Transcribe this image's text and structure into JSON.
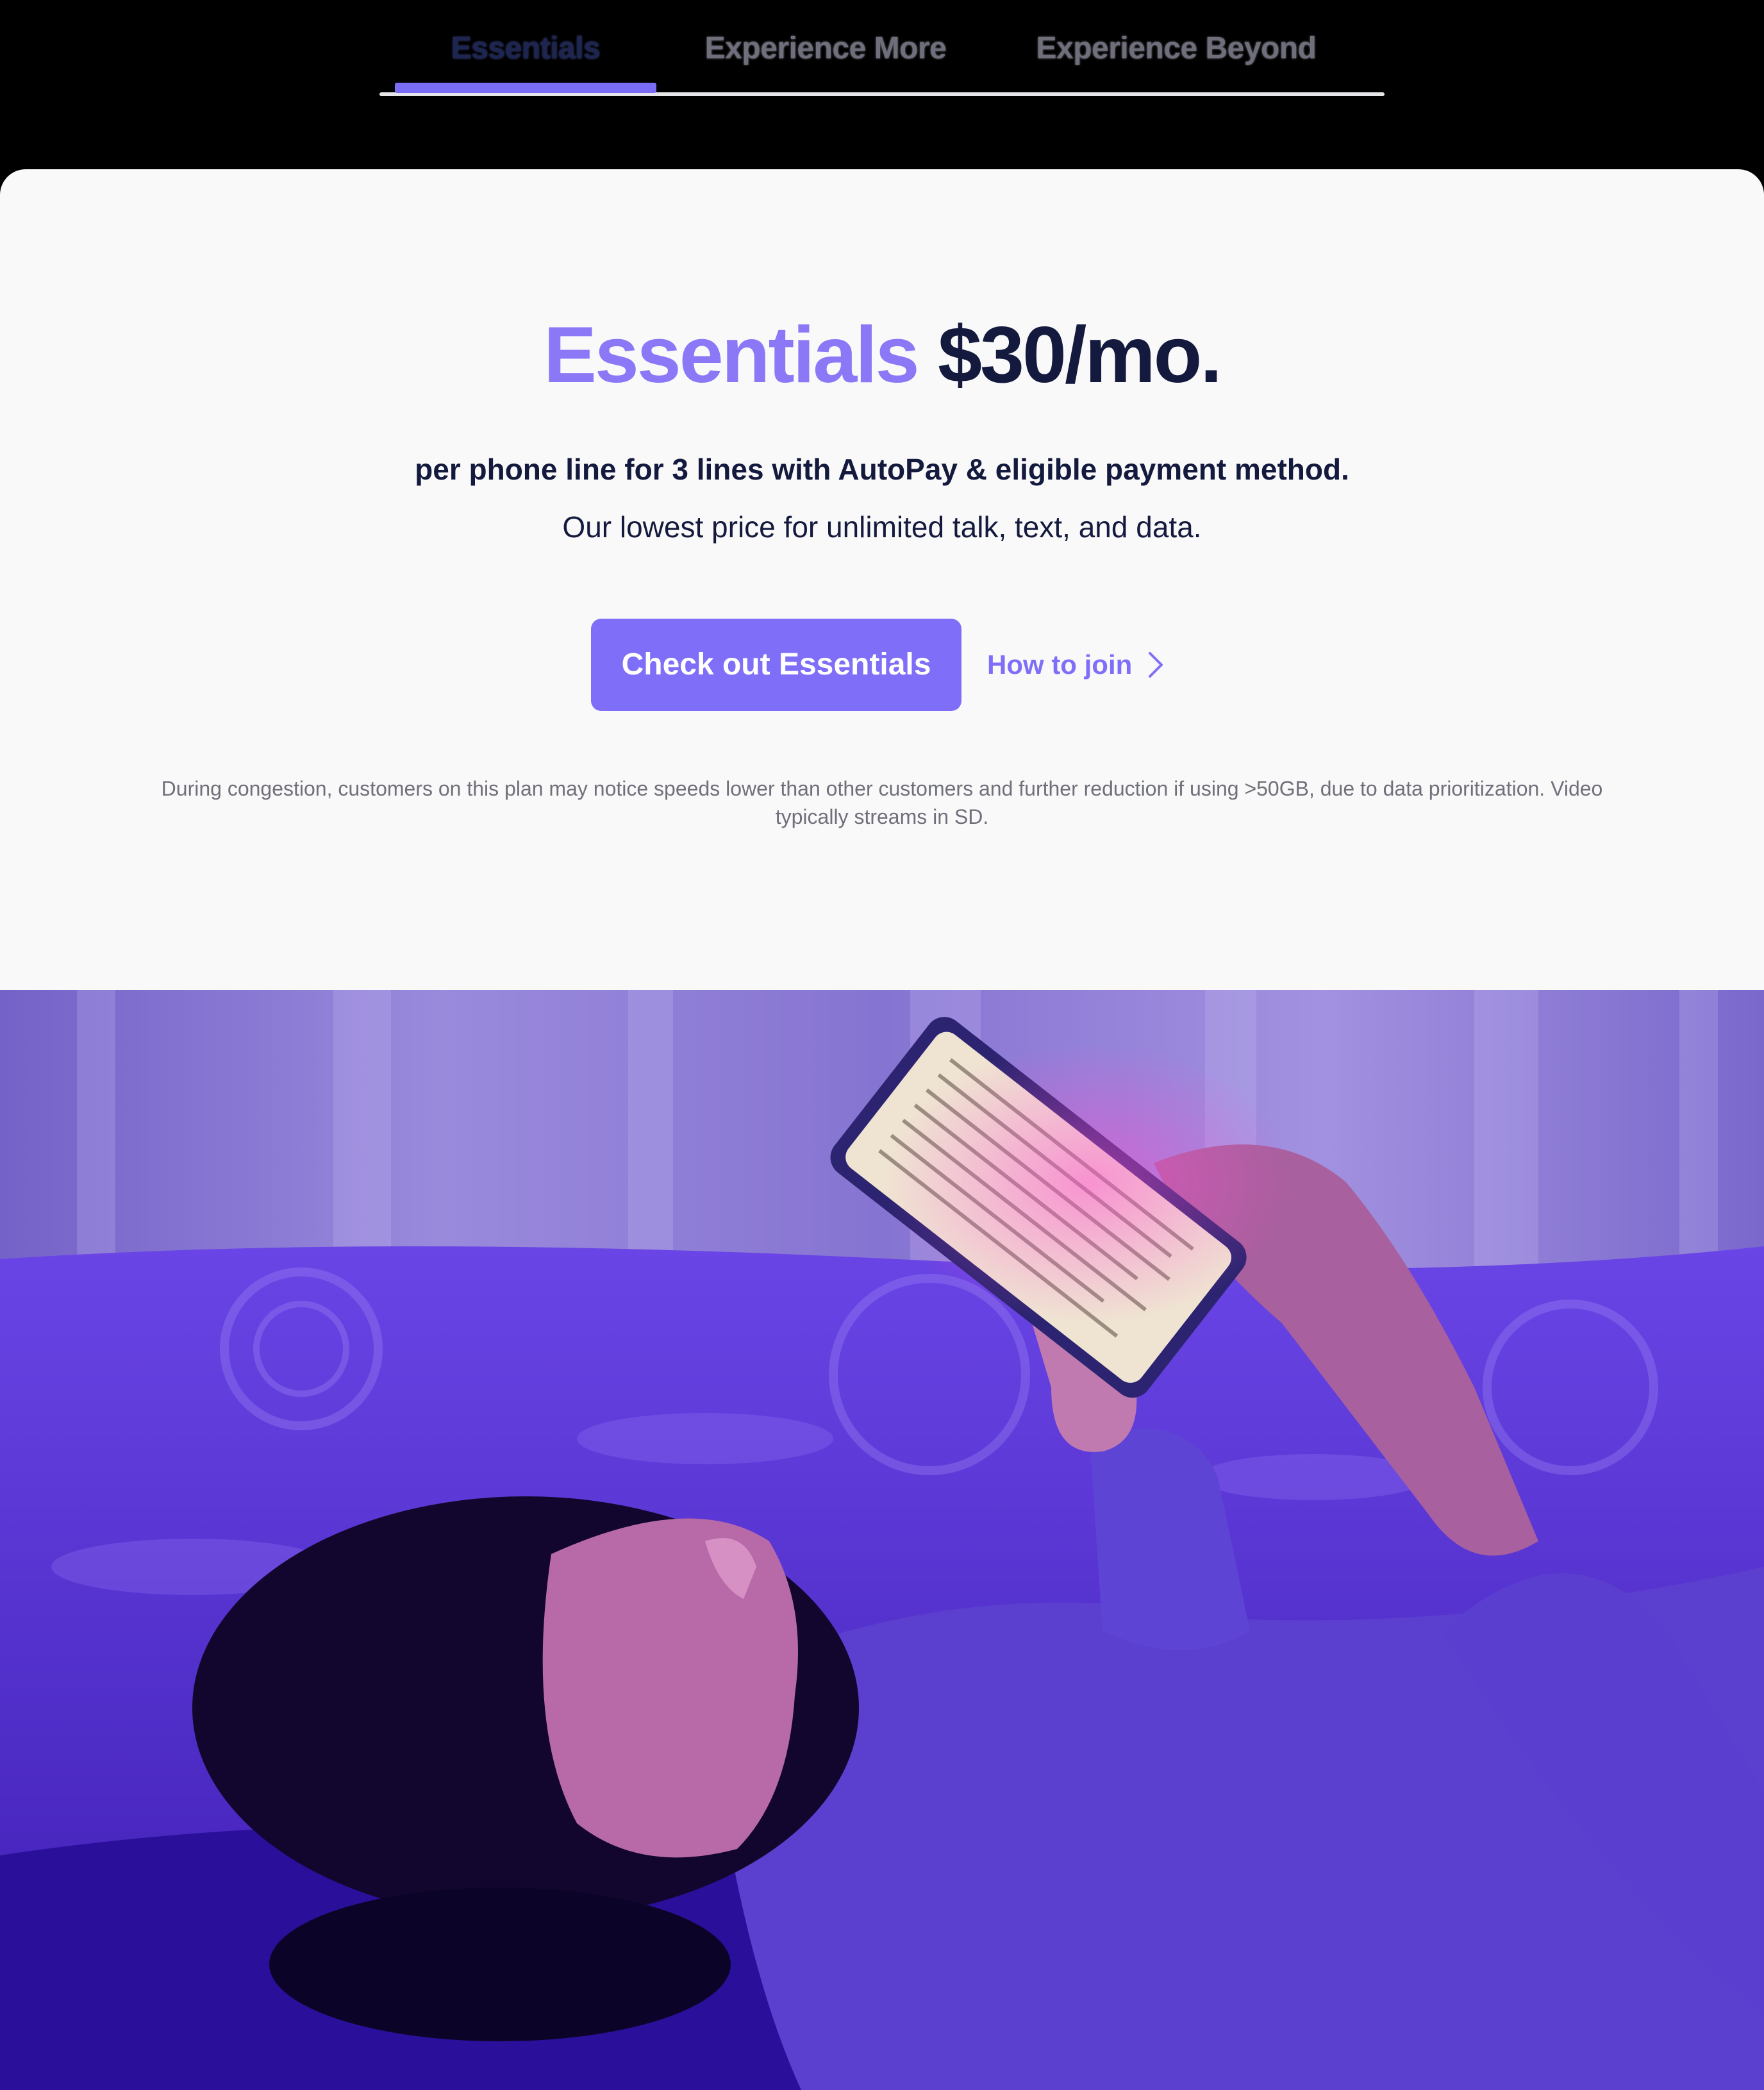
{
  "tabs": [
    {
      "label": "Essentials",
      "active": true
    },
    {
      "label": "Experience More",
      "active": false
    },
    {
      "label": "Experience Beyond",
      "active": false
    }
  ],
  "hero": {
    "plan_name": "Essentials",
    "price": "$30/mo.",
    "subhead": "per phone line for 3 lines with AutoPay & eligible payment method.",
    "tagline": "Our lowest price for unlimited talk, text, and data.",
    "primary_cta": "Check out Essentials",
    "secondary_cta": "How to join",
    "disclaimer": "During congestion, customers on this plan may notice speeds lower than other customers and further reduction if using >50GB, due to data prioritization. Video typically streams in SD."
  },
  "colors": {
    "accent": "#7f6ff8",
    "navy": "#141a3d",
    "page_background": "#f9f9fa",
    "muted_text": "#6f7079"
  },
  "icons": {
    "secondary_cta": "chevron-right-icon"
  }
}
